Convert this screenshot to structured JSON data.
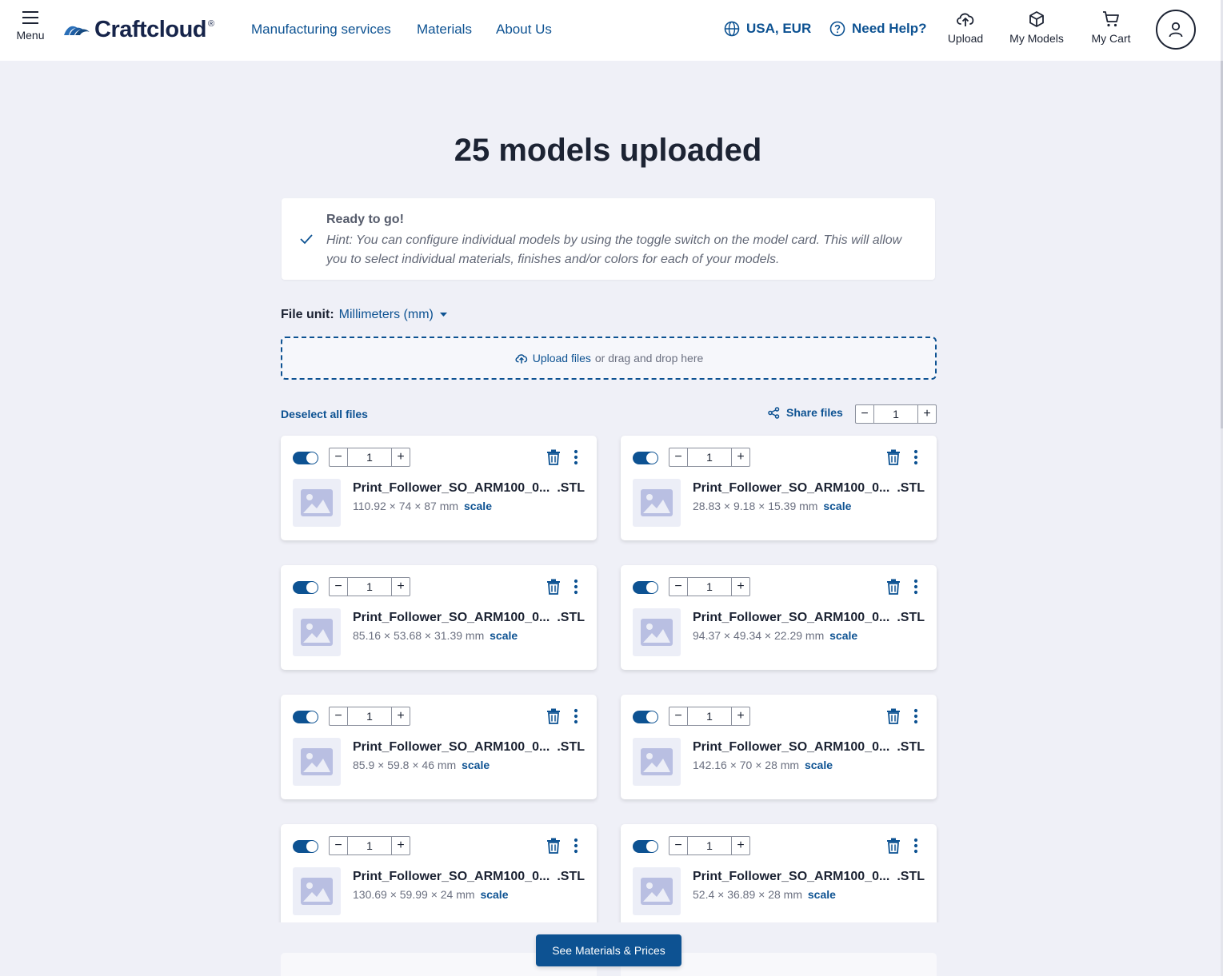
{
  "header": {
    "menu_label": "Menu",
    "brand": "Craftcloud",
    "brand_mark": "®",
    "nav": [
      "Manufacturing services",
      "Materials",
      "About Us"
    ],
    "region": "USA, EUR",
    "help": "Need Help?",
    "upload_label": "Upload",
    "models_label": "My Models",
    "cart_label": "My Cart"
  },
  "page": {
    "title": "25 models uploaded"
  },
  "hint": {
    "title": "Ready to go!",
    "text": "Hint: You can configure individual models by using the toggle switch on the model card. This will allow you to select individual materials, finishes and/or colors for each of your models."
  },
  "file_unit": {
    "label": "File unit:",
    "value": "Millimeters (mm)"
  },
  "dropzone": {
    "link": "Upload files",
    "text": "or drag and drop here"
  },
  "toolbar": {
    "deselect": "Deselect all files",
    "share": "Share files",
    "global_qty": "1"
  },
  "models": [
    {
      "name": "Print_Follower_SO_ARM100_0...",
      "ext": ".STL",
      "dims": "110.92 × 74 × 87 mm",
      "qty": "1",
      "enabled": true
    },
    {
      "name": "Print_Follower_SO_ARM100_0...",
      "ext": ".STL",
      "dims": "28.83 × 9.18 × 15.39 mm",
      "qty": "1",
      "enabled": true
    },
    {
      "name": "Print_Follower_SO_ARM100_0...",
      "ext": ".STL",
      "dims": "85.16 × 53.68 × 31.39 mm",
      "qty": "1",
      "enabled": true
    },
    {
      "name": "Print_Follower_SO_ARM100_0...",
      "ext": ".STL",
      "dims": "94.37 × 49.34 × 22.29 mm",
      "qty": "1",
      "enabled": true
    },
    {
      "name": "Print_Follower_SO_ARM100_0...",
      "ext": ".STL",
      "dims": "85.9 × 59.8 × 46 mm",
      "qty": "1",
      "enabled": true
    },
    {
      "name": "Print_Follower_SO_ARM100_0...",
      "ext": ".STL",
      "dims": "142.16 × 70 × 28 mm",
      "qty": "1",
      "enabled": true
    },
    {
      "name": "Print_Follower_SO_ARM100_0...",
      "ext": ".STL",
      "dims": "130.69 × 59.99 × 24 mm",
      "qty": "1",
      "enabled": true
    },
    {
      "name": "Print_Follower_SO_ARM100_0...",
      "ext": ".STL",
      "dims": "52.4 × 36.89 × 28 mm",
      "qty": "1",
      "enabled": true
    }
  ],
  "scale_label": "scale",
  "cta": "See Materials & Prices",
  "colors": {
    "primary": "#0d5292",
    "background": "#eff0f7",
    "text": "#1c2333"
  }
}
